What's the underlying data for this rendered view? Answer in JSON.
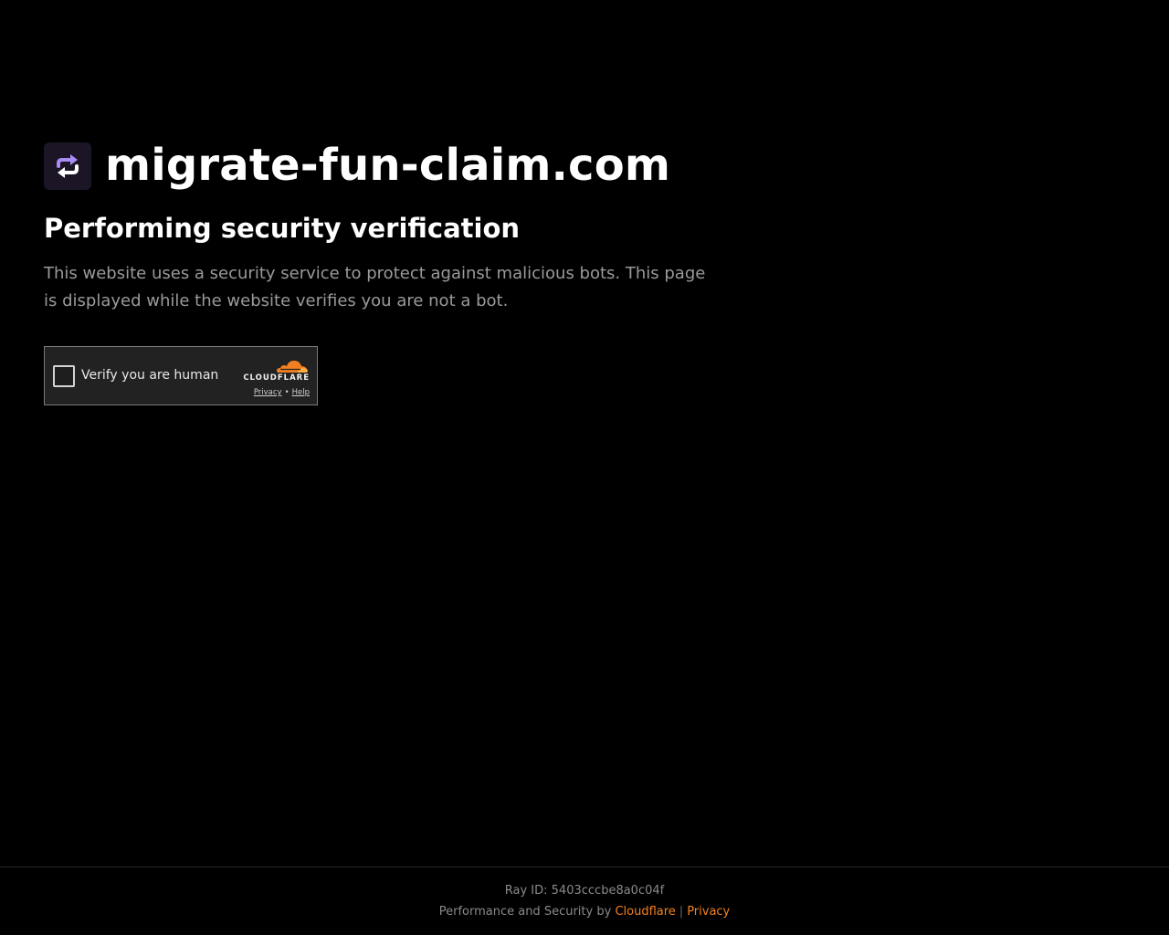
{
  "site": {
    "name": "migrate-fun-claim.com",
    "favicon_icon": "sync-arrows-icon",
    "favicon_color": "#9f7aea"
  },
  "main": {
    "heading": "Performing security verification",
    "description": "This website uses a security service to protect against malicious bots. This page is displayed while the website verifies you are not a bot."
  },
  "widget": {
    "checkbox_label": "Verify you are human",
    "checked": false,
    "brand_name": "CLOUDFLARE",
    "brand_icon": "cloudflare-cloud-icon",
    "privacy_link": "Privacy",
    "separator": "•",
    "help_link": "Help"
  },
  "footer": {
    "ray_id": "Ray ID: 5403cccbe8a0c04f",
    "performance_prefix": "Performance and Security by",
    "cloudflare_link": "Cloudflare",
    "separator": "|",
    "privacy_link": "Privacy",
    "link_color": "#f38020"
  }
}
